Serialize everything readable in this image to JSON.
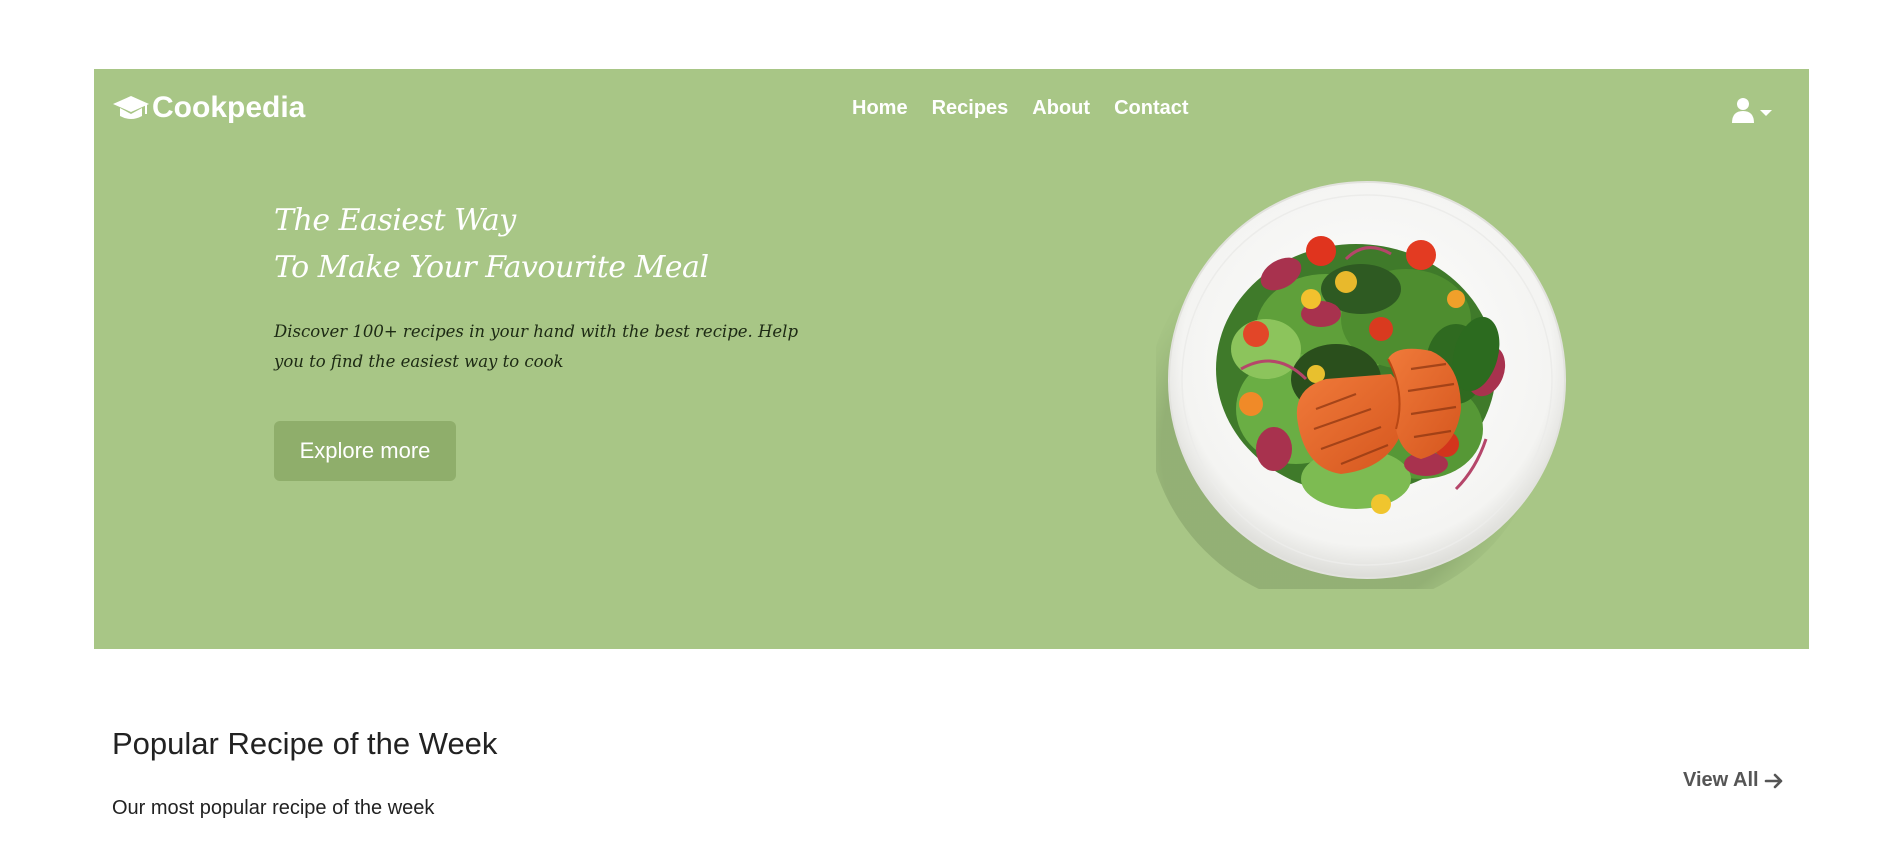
{
  "brand": {
    "name": "Cookpedia",
    "icon": "graduation-cap-icon"
  },
  "nav": {
    "links": [
      {
        "label": "Home"
      },
      {
        "label": "Recipes"
      },
      {
        "label": "About"
      },
      {
        "label": "Contact"
      }
    ]
  },
  "user_menu": {
    "icon": "user-icon",
    "dropdown_icon": "caret-down-icon"
  },
  "hero": {
    "title_line1": "The Easiest Way",
    "title_line2": "To Make Your Favourite Meal",
    "description": "Discover 100+ recipes in your hand with the best recipe. Help you to find the easiest way to cook",
    "cta_label": "Explore more",
    "image_icon": "salmon-salad-plate-image"
  },
  "popular": {
    "title": "Popular Recipe of the Week",
    "subtitle": "Our most popular recipe of the week",
    "view_all_label": "View All",
    "view_all_icon": "arrow-right-icon"
  },
  "colors": {
    "hero_bg": "#a8c686",
    "button_bg": "#8fae6b",
    "text_dark": "#222222",
    "link_gray": "#555555"
  }
}
